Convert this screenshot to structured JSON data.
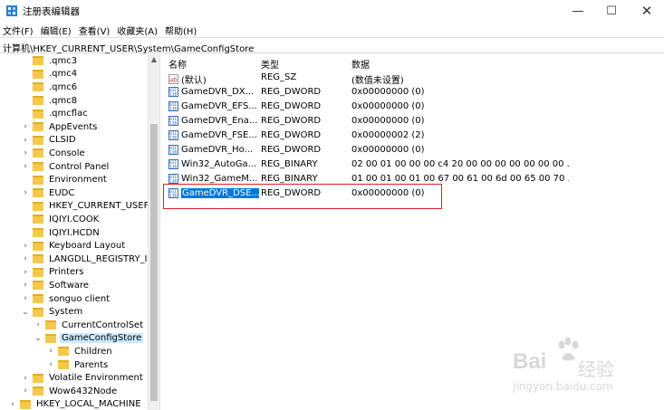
{
  "window": {
    "title": "注册表编辑器",
    "minimize": "—",
    "maximize": "☐",
    "close": "✕"
  },
  "menu": [
    "文件(F)",
    "编辑(E)",
    "查看(V)",
    "收藏夹(A)",
    "帮助(H)"
  ],
  "address": "计算机\\HKEY_CURRENT_USER\\System\\GameConfigStore",
  "tree": [
    {
      "label": ".qmc3",
      "expander": ""
    },
    {
      "label": ".qmc4",
      "expander": ""
    },
    {
      "label": ".qmc6",
      "expander": ""
    },
    {
      "label": ".qmc8",
      "expander": ""
    },
    {
      "label": ".qmcflac",
      "expander": ""
    },
    {
      "label": "AppEvents",
      "expander": "›"
    },
    {
      "label": "CLSID",
      "expander": "›"
    },
    {
      "label": "Console",
      "expander": "›"
    },
    {
      "label": "Control Panel",
      "expander": "›"
    },
    {
      "label": "Environment",
      "expander": ""
    },
    {
      "label": "EUDC",
      "expander": "›"
    },
    {
      "label": "HKEY_CURRENT_USEF",
      "expander": ""
    },
    {
      "label": "IQIYI.COOK",
      "expander": ""
    },
    {
      "label": "IQIYI.HCDN",
      "expander": ""
    },
    {
      "label": "Keyboard Layout",
      "expander": "›"
    },
    {
      "label": "LANGDLL_REGISTRY_I",
      "expander": "›"
    },
    {
      "label": "Printers",
      "expander": "›"
    },
    {
      "label": "Software",
      "expander": "›"
    },
    {
      "label": "songuo client",
      "expander": "›"
    },
    {
      "label": "System",
      "expander": "⌄"
    },
    {
      "label": "CurrentControlSet",
      "expander": "›"
    },
    {
      "label": "GameConfigStore",
      "expander": "⌄",
      "selected": true
    },
    {
      "label": "Children",
      "expander": "›"
    },
    {
      "label": "Parents",
      "expander": "›"
    },
    {
      "label": "Volatile Environment",
      "expander": "›"
    },
    {
      "label": "Wow6432Node",
      "expander": "›"
    },
    {
      "label": "HKEY_LOCAL_MACHINE",
      "expander": "›"
    }
  ],
  "list_header": {
    "name": "名称",
    "type": "类型",
    "data": "数据"
  },
  "values": [
    {
      "icon": "string-value-icon",
      "name": "(默认)",
      "type": "REG_SZ",
      "data": "(数值未设置)"
    },
    {
      "icon": "binary-value-icon",
      "name": "GameDVR_DX...",
      "type": "REG_DWORD",
      "data": "0x00000000 (0)"
    },
    {
      "icon": "binary-value-icon",
      "name": "GameDVR_EFS...",
      "type": "REG_DWORD",
      "data": "0x00000000 (0)"
    },
    {
      "icon": "binary-value-icon",
      "name": "GameDVR_Ena...",
      "type": "REG_DWORD",
      "data": "0x00000000 (0)"
    },
    {
      "icon": "binary-value-icon",
      "name": "GameDVR_FSE...",
      "type": "REG_DWORD",
      "data": "0x00000002 (2)"
    },
    {
      "icon": "binary-value-icon",
      "name": "GameDVR_Ho...",
      "type": "REG_DWORD",
      "data": "0x00000000 (0)"
    },
    {
      "icon": "binary-value-icon",
      "name": "Win32_AutoGa...",
      "type": "REG_BINARY",
      "data": "02 00 01 00 00 00 c4 20 00 00 00 00 00 00 00 ..."
    },
    {
      "icon": "binary-value-icon",
      "name": "Win32_GameM...",
      "type": "REG_BINARY",
      "data": "01 00 01 00 01 00 67 00 61 00 6d 00 65 00 70 ..."
    },
    {
      "icon": "binary-value-icon",
      "name": "GameDVR_DSE...",
      "type": "REG_DWORD",
      "data": "0x00000000 (0)",
      "selected": true
    }
  ],
  "watermark": {
    "brand": "Bai",
    "zh": "经验",
    "url": "jingyan.baidu.com"
  },
  "colors": {
    "selection": "#0078d7",
    "tree_selection": "#cce8ff",
    "highlight": "#e02020",
    "folder": "#f4c84b"
  }
}
